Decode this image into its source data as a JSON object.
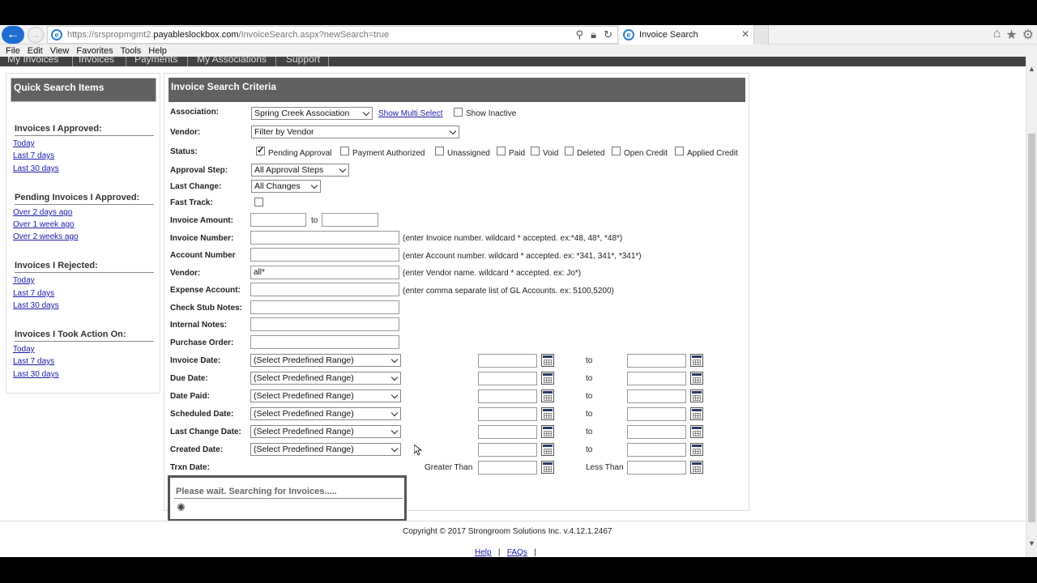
{
  "browser": {
    "url_prefix": "https://srspropmgmt2.",
    "url_domain": "payableslockbox.com",
    "url_path": "/InvoiceSearch.aspx?newSearch=true",
    "tab_title": "Invoice Search",
    "menu": [
      "File",
      "Edit",
      "View",
      "Favorites",
      "Tools",
      "Help"
    ]
  },
  "nav": [
    "My Invoices",
    "Invoices",
    "Payments",
    "My Associations",
    "Support"
  ],
  "quick": {
    "title": "Quick Search Items",
    "sections": [
      {
        "title": "Invoices I Approved:",
        "links": [
          "Today",
          "Last 7 days",
          "Last 30 days"
        ]
      },
      {
        "title": "Pending Invoices I Approved:",
        "links": [
          "Over 2 days ago",
          "Over 1 week ago",
          "Over 2 weeks ago"
        ]
      },
      {
        "title": "Invoices I Rejected:",
        "links": [
          "Today",
          "Last 7 days",
          "Last 30 days"
        ]
      },
      {
        "title": "Invoices I Took Action On:",
        "links": [
          "Today",
          "Last 7 days",
          "Last 30 days"
        ]
      }
    ]
  },
  "criteria": {
    "title": "Invoice Search Criteria",
    "association_label": "Association:",
    "association_value": "Spring Creek Association",
    "show_multi_select": "Show Multi Select",
    "show_inactive": "Show Inactive",
    "vendor_label": "Vendor:",
    "vendor_filter": "Filter by Vendor",
    "status_label": "Status:",
    "statuses": [
      {
        "label": "Pending Approval",
        "checked": true
      },
      {
        "label": "Payment Authorized",
        "checked": false
      },
      {
        "label": "Unassigned",
        "checked": false
      },
      {
        "label": "Paid",
        "checked": false
      },
      {
        "label": "Void",
        "checked": false
      },
      {
        "label": "Deleted",
        "checked": false
      },
      {
        "label": "Open Credit",
        "checked": false
      },
      {
        "label": "Applied Credit",
        "checked": false
      }
    ],
    "approval_step_label": "Approval Step:",
    "approval_step_value": "All Approval Steps",
    "last_change_label": "Last Change:",
    "last_change_value": "All Changes",
    "fast_track_label": "Fast Track:",
    "invoice_amount_label": "Invoice Amount:",
    "to": "to",
    "invoice_number_label": "Invoice Number:",
    "invoice_number_hint": "(enter Invoice number. wildcard * accepted. ex:*48, 48*, *48*)",
    "account_number_label": "Account Number",
    "account_number_hint": "(enter Account number. wildcard * accepted. ex: *341, 341*, *341*)",
    "vendor2_label": "Vendor:",
    "vendor2_value": "all*",
    "vendor2_hint": "(enter Vendor name. wildcard * accepted. ex: Jo*)",
    "expense_label": "Expense Account:",
    "expense_hint": "(enter comma separate list of GL Accounts. ex: 5100,5200)",
    "check_stub_label": "Check Stub Notes:",
    "internal_notes_label": "Internal Notes:",
    "purchase_order_label": "Purchase Order:",
    "date_rows": [
      {
        "label": "Invoice Date:",
        "range": "(Select Predefined Range)",
        "to": "to"
      },
      {
        "label": "Due Date:",
        "range": "(Select Predefined Range)",
        "to": "to"
      },
      {
        "label": "Date Paid:",
        "range": "(Select Predefined Range)",
        "to": "to"
      },
      {
        "label": "Scheduled Date:",
        "range": "(Select Predefined Range)",
        "to": "to"
      },
      {
        "label": "Last Change Date:",
        "range": "(Select Predefined Range)",
        "to": "to"
      },
      {
        "label": "Created Date:",
        "range": "(Select Predefined Range)",
        "to": "to"
      }
    ],
    "trxn_label": "Trxn Date:",
    "greater_than": "Greater Than",
    "less_than": "Less Than"
  },
  "wait": {
    "text": "Please wait. Searching for Invoices....."
  },
  "footer": {
    "copyright": "Copyright © 2017 Strongroom Solutions Inc. v.4.12.1.2467",
    "help": "Help",
    "faqs": "FAQs",
    "sep": "|"
  }
}
